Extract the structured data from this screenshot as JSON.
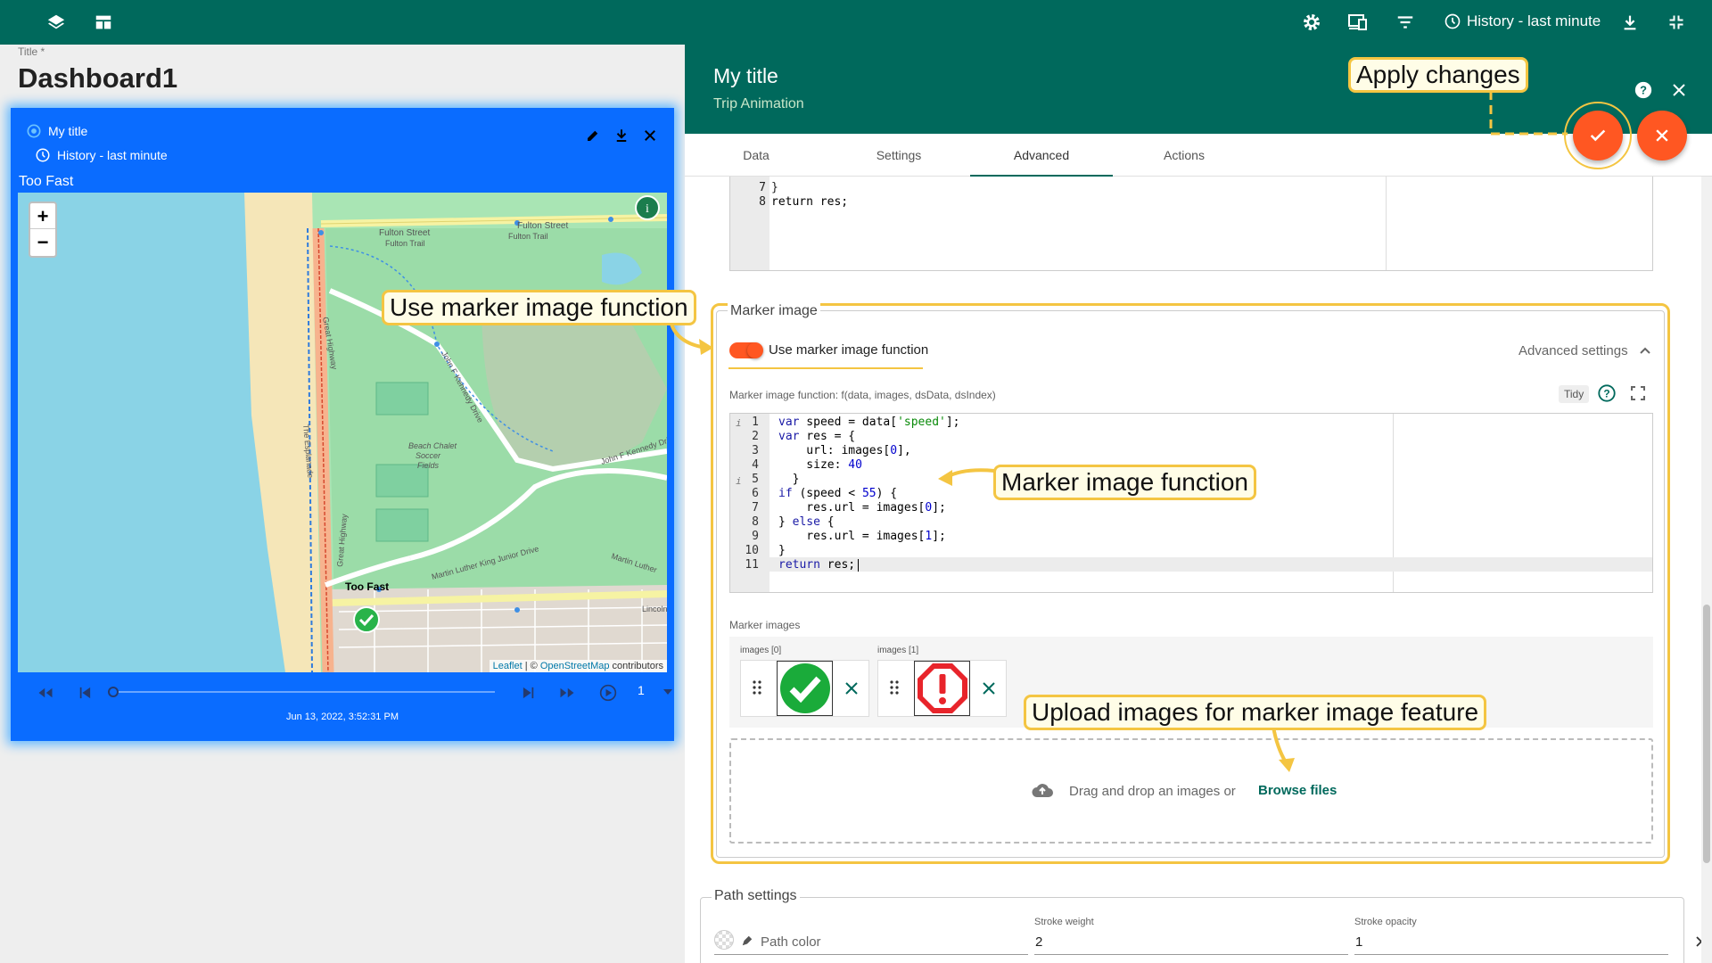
{
  "topbar": {
    "history_label": "History - last minute"
  },
  "dashboard": {
    "title_label": "Title *",
    "title": "Dashboard1"
  },
  "widget": {
    "title": "My title",
    "subtitle": "History - last minute",
    "label": "Too Fast",
    "map": {
      "zoom_in": "+",
      "zoom_out": "−",
      "attribution_leaflet": "Leaflet",
      "attribution_sep": " | © ",
      "attribution_osm": "OpenStreetMap",
      "attribution_tail": " contributors",
      "labels": {
        "fulton_st": "Fulton Street",
        "fulton_trail": "Fulton Trail",
        "fulton_st2": "Fulton Street",
        "fulton_trail2": "Fulton Trail",
        "great_hwy": "Great Highway",
        "great_hwy2": "Great Highway",
        "esplanade": "The Esplanade",
        "jfk": "John F Kennedy Drive",
        "jfk2": "John F Kennedy Drive",
        "mlk": "Martin Luther King Junior Drive",
        "mlk2": "Martin Luther",
        "soccer1": "Beach Chalet",
        "soccer2": "Soccer",
        "soccer3": "Fields",
        "toofast": "Too Fast",
        "lincoln": "Lincoln"
      }
    },
    "player": {
      "date": "Jun 13, 2022, 3:52:31 PM",
      "speed": "1"
    }
  },
  "panel": {
    "title": "My title",
    "subtitle": "Trip Animation",
    "tabs": [
      "Data",
      "Settings",
      "Advanced",
      "Actions"
    ],
    "top_code": [
      {
        "n": "7",
        "t": "}"
      },
      {
        "n": "8",
        "t": "return res;"
      }
    ],
    "marker_image": {
      "legend": "Marker image",
      "toggle_label": "Use marker image function",
      "toggle_on": true,
      "advanced": "Advanced settings",
      "function_label": "Marker image function: f(data, images, dsData, dsIndex)",
      "tidy": "Tidy",
      "code": [
        {
          "n": "1",
          "t": "var speed = data['speed'];"
        },
        {
          "n": "2",
          "t": "var res = {"
        },
        {
          "n": "3",
          "t": "    url: images[0],"
        },
        {
          "n": "4",
          "t": "    size: 40"
        },
        {
          "n": "5",
          "t": "  }"
        },
        {
          "n": "6",
          "t": "if (speed < 55) {"
        },
        {
          "n": "7",
          "t": "    res.url = images[0];"
        },
        {
          "n": "8",
          "t": "} else {"
        },
        {
          "n": "9",
          "t": "    res.url = images[1];"
        },
        {
          "n": "10",
          "t": "}"
        },
        {
          "n": "11",
          "t": "return res;"
        }
      ],
      "images_label": "Marker images",
      "images": [
        {
          "label": "images [0]",
          "icon": "check-marker"
        },
        {
          "label": "images [1]",
          "icon": "alert-marker"
        }
      ],
      "drop_text": "Drag and drop an images or",
      "browse": "Browse files"
    },
    "path": {
      "legend": "Path settings",
      "color_placeholder": "Path color",
      "stroke_weight_label": "Stroke weight",
      "stroke_weight": "2",
      "stroke_opacity_label": "Stroke opacity",
      "stroke_opacity": "1"
    }
  },
  "callouts": {
    "apply": "Apply changes",
    "use_fn": "Use marker image function",
    "fn": "Marker image function",
    "upload": "Upload images for marker image feature"
  },
  "colors": {
    "header": "#00695c",
    "widget": "#0a6cff",
    "accent": "#ff5722",
    "callout_border": "#f4c542"
  }
}
